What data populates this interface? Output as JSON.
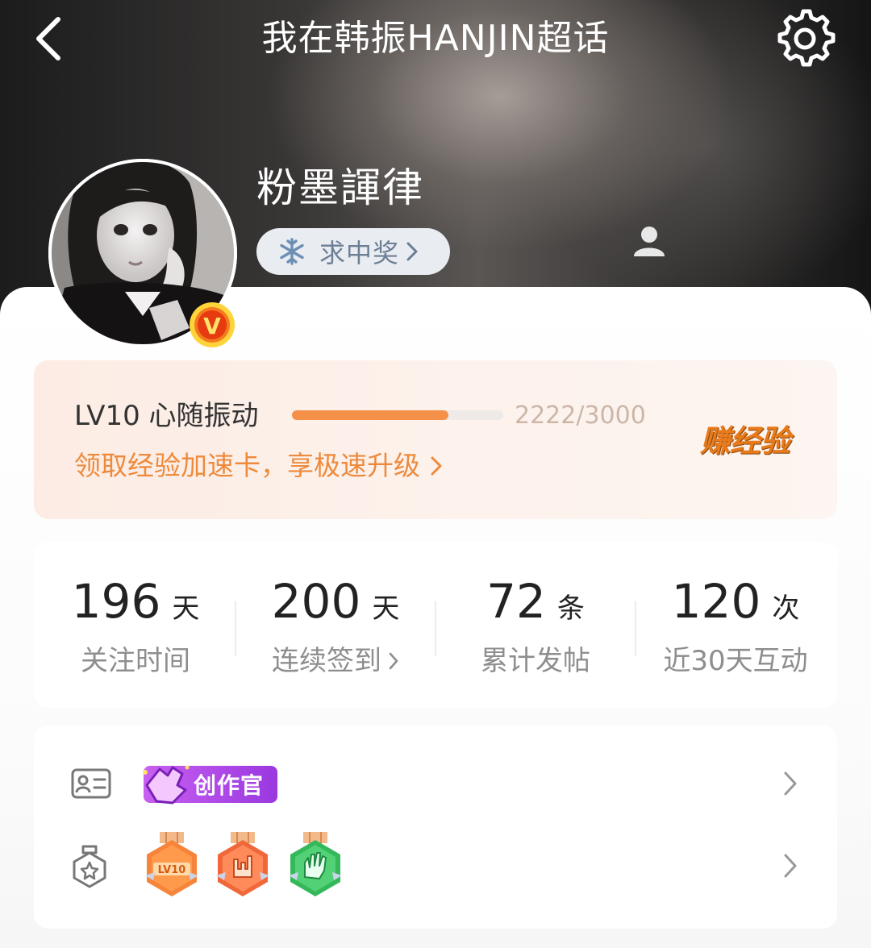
{
  "header": {
    "title": "我在韩振HANJIN超话",
    "back_icon": "back-arrow-icon",
    "settings_icon": "gear-icon"
  },
  "profile": {
    "username": "粉墨諢律",
    "tag_label": "求中奖",
    "verified_badge": "V"
  },
  "level": {
    "name": "LV10 心随振动",
    "progress_text": "2222/3000",
    "progress_current": 2222,
    "progress_max": 3000,
    "promo_text": "领取经验加速卡，享极速升级",
    "earn_label": "赚经验",
    "accent_color": "#f59048"
  },
  "stats": [
    {
      "value": "196",
      "unit": "天",
      "label": "关注时间",
      "link": false
    },
    {
      "value": "200",
      "unit": "天",
      "label": "连续签到",
      "link": true
    },
    {
      "value": "72",
      "unit": "条",
      "label": "累计发帖",
      "link": false
    },
    {
      "value": "120",
      "unit": "次",
      "label": "近30天互动",
      "link": false
    }
  ],
  "badges": {
    "creator_label": "创作官",
    "medals": [
      {
        "icon": "lv10-medal-icon",
        "text": "LV10"
      },
      {
        "icon": "rock-hand-medal-icon",
        "text": ""
      },
      {
        "icon": "wave-hand-medal-icon",
        "text": ""
      }
    ]
  }
}
